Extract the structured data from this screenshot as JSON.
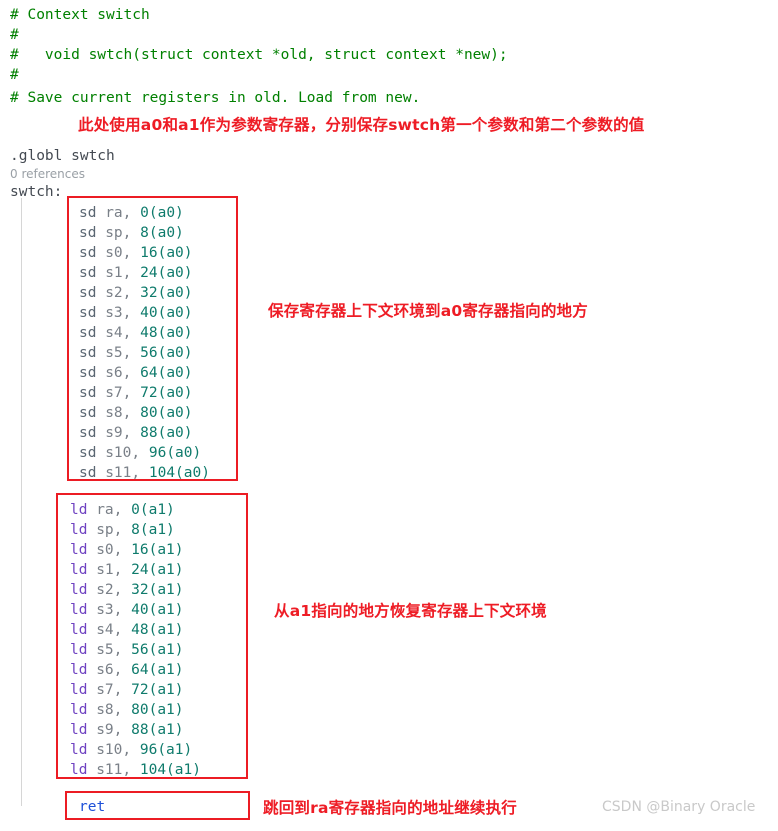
{
  "editor": {
    "header_comments": [
      "# Context switch",
      "#",
      "#   void swtch(struct context *old, struct context *new);",
      "#",
      "# Save current registers in old. Load from new."
    ],
    "directive": ".globl swtch",
    "codelens": "0 references",
    "label": "swtch:",
    "save_block": {
      "mnemonic": "sd",
      "lines": [
        {
          "mnemonic": "sd",
          "reg": "ra",
          "operand": "0(a0)"
        },
        {
          "mnemonic": "sd",
          "reg": "sp",
          "operand": "8(a0)"
        },
        {
          "mnemonic": "sd",
          "reg": "s0",
          "operand": "16(a0)"
        },
        {
          "mnemonic": "sd",
          "reg": "s1",
          "operand": "24(a0)"
        },
        {
          "mnemonic": "sd",
          "reg": "s2",
          "operand": "32(a0)"
        },
        {
          "mnemonic": "sd",
          "reg": "s3",
          "operand": "40(a0)"
        },
        {
          "mnemonic": "sd",
          "reg": "s4",
          "operand": "48(a0)"
        },
        {
          "mnemonic": "sd",
          "reg": "s5",
          "operand": "56(a0)"
        },
        {
          "mnemonic": "sd",
          "reg": "s6",
          "operand": "64(a0)"
        },
        {
          "mnemonic": "sd",
          "reg": "s7",
          "operand": "72(a0)"
        },
        {
          "mnemonic": "sd",
          "reg": "s8",
          "operand": "80(a0)"
        },
        {
          "mnemonic": "sd",
          "reg": "s9",
          "operand": "88(a0)"
        },
        {
          "mnemonic": "sd",
          "reg": "s10",
          "operand": "96(a0)"
        },
        {
          "mnemonic": "sd",
          "reg": "s11",
          "operand": "104(a0)"
        }
      ]
    },
    "load_block": {
      "mnemonic": "ld",
      "lines": [
        {
          "mnemonic": "ld",
          "reg": "ra",
          "operand": "0(a1)"
        },
        {
          "mnemonic": "ld",
          "reg": "sp",
          "operand": "8(a1)"
        },
        {
          "mnemonic": "ld",
          "reg": "s0",
          "operand": "16(a1)"
        },
        {
          "mnemonic": "ld",
          "reg": "s1",
          "operand": "24(a1)"
        },
        {
          "mnemonic": "ld",
          "reg": "s2",
          "operand": "32(a1)"
        },
        {
          "mnemonic": "ld",
          "reg": "s3",
          "operand": "40(a1)"
        },
        {
          "mnemonic": "ld",
          "reg": "s4",
          "operand": "48(a1)"
        },
        {
          "mnemonic": "ld",
          "reg": "s5",
          "operand": "56(a1)"
        },
        {
          "mnemonic": "ld",
          "reg": "s6",
          "operand": "64(a1)"
        },
        {
          "mnemonic": "ld",
          "reg": "s7",
          "operand": "72(a1)"
        },
        {
          "mnemonic": "ld",
          "reg": "s8",
          "operand": "80(a1)"
        },
        {
          "mnemonic": "ld",
          "reg": "s9",
          "operand": "88(a1)"
        },
        {
          "mnemonic": "ld",
          "reg": "s10",
          "operand": "96(a1)"
        },
        {
          "mnemonic": "ld",
          "reg": "s11",
          "operand": "104(a1)"
        }
      ]
    },
    "return_line": "ret"
  },
  "annotations": {
    "top": "此处使用a0和a1作为参数寄存器，分别保存swtch第一个参数和第二个参数的值",
    "save_block": "保存寄存器上下文环境到a0寄存器指向的地方",
    "load_block": "从a1指向的地方恢复寄存器上下文环境",
    "return": "跳回到ra寄存器指向的地址继续执行"
  },
  "watermark": "CSDN @Binary Oracle",
  "colors": {
    "comment": "#008000",
    "annotation_red": "#ee1c25",
    "box_red": "#ec1c24",
    "keyword_purple": "#6f42c1",
    "keyword_blue": "#1c4fd8",
    "number_teal": "#0f7b6c",
    "register_gray": "#7a8088",
    "watermark_gray": "#c9c9c9"
  }
}
